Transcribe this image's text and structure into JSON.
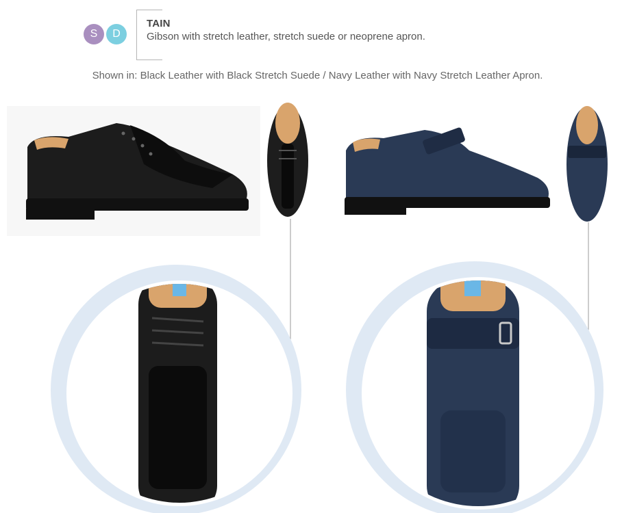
{
  "product": {
    "size_badges": [
      "S",
      "D"
    ],
    "name": "TAIN",
    "description": "Gibson with stretch leather, stretch suede or neoprene apron.",
    "shown_in": "Shown in: Black Leather with Black Stretch Suede / Navy Leather with Navy Stretch Leather Apron."
  },
  "colors": {
    "badge_s": "#a98fbf",
    "badge_d": "#7ccfe0",
    "black_leather": "#1a1a1a",
    "navy_leather": "#26354e",
    "halo": "#dfe9f4"
  }
}
